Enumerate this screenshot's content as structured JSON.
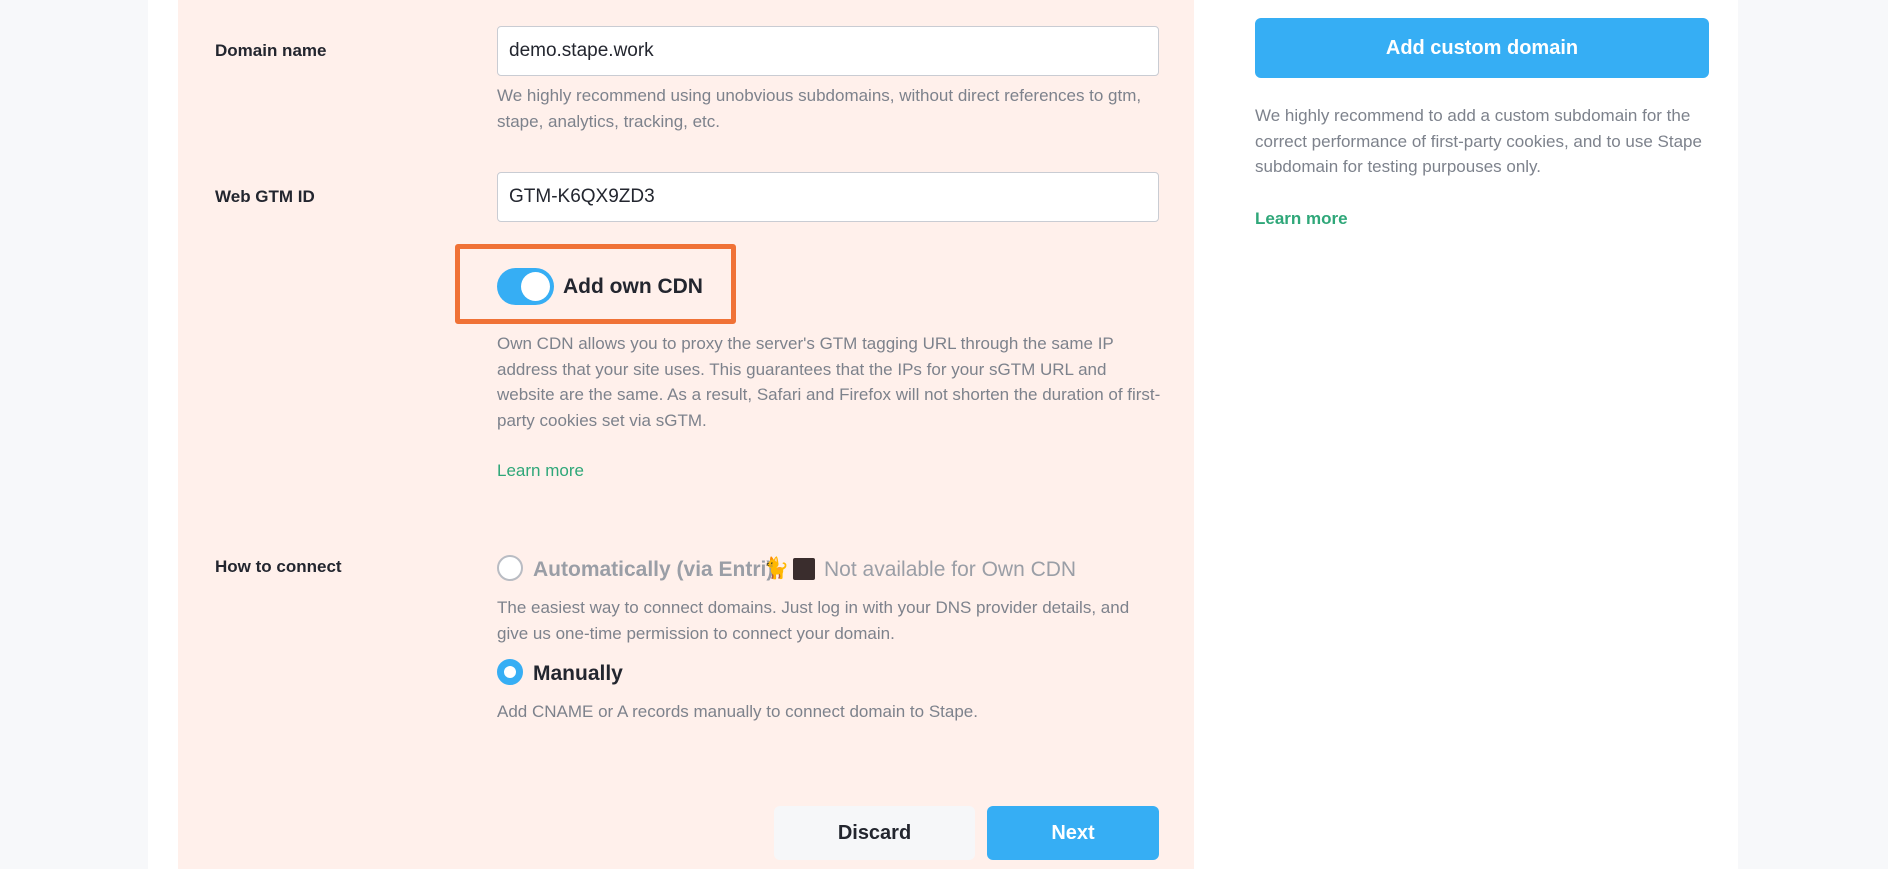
{
  "form": {
    "domain": {
      "label": "Domain name",
      "value": "demo.stape.work",
      "help": "We highly recommend using unobvious subdomains, without direct references to gtm, stape, analytics, tracking, etc."
    },
    "gtm": {
      "label": "Web GTM ID",
      "value": "GTM-K6QX9ZD3"
    },
    "cdn": {
      "toggle_label": "Add own CDN",
      "enabled": true,
      "description": "Own CDN allows you to proxy the server's GTM tagging URL through the same IP address that your site uses. This guarantees that the IPs for your sGTM URL and website are the same. As a result, Safari and Firefox will not shorten the duration of first-party cookies set via sGTM.",
      "learn_more": "Learn more"
    },
    "connect": {
      "label": "How to connect",
      "auto": {
        "label": "Automatically (via Entri)",
        "emoji": "🐈",
        "unavailable_note": "Not available for Own CDN",
        "description": "The easiest way to connect domains. Just log in with your DNS provider details, and give us one-time permission to connect your domain.",
        "selected": false
      },
      "manual": {
        "label": "Manually",
        "description": "Add CNAME or A records manually to connect domain to Stape.",
        "selected": true
      }
    },
    "buttons": {
      "discard": "Discard",
      "next": "Next"
    }
  },
  "sidebar": {
    "button": "Add custom domain",
    "text": "We highly recommend to add a custom subdomain for the correct performance of first-party cookies, and to use Stape subdomain for testing purpouses only.",
    "learn_more": "Learn more"
  },
  "colors": {
    "accent": "#36aef4",
    "highlight": "#f07236",
    "link": "#2fa779",
    "panel": "#fff0eb"
  }
}
